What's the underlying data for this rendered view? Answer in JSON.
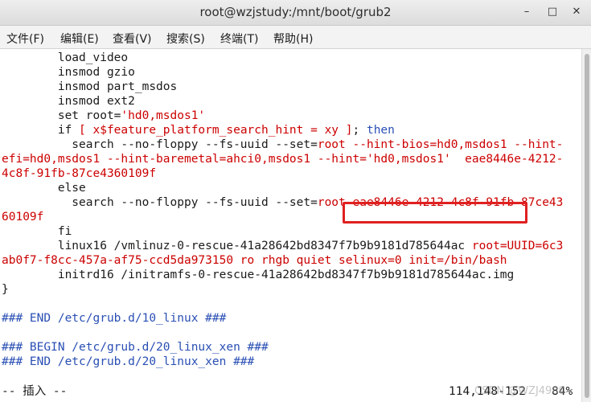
{
  "window": {
    "title": "root@wzjstudy:/mnt/boot/grub2",
    "minimize_glyph": "–",
    "maximize_glyph": "□",
    "close_glyph": "✕"
  },
  "menu": [
    "文件(F)",
    "编辑(E)",
    "查看(V)",
    "搜索(S)",
    "终端(T)",
    "帮助(H)"
  ],
  "lines": [
    [
      {
        "t": "        load_video",
        "c": ""
      }
    ],
    [
      {
        "t": "        insmod gzio",
        "c": ""
      }
    ],
    [
      {
        "t": "        insmod part_msdos",
        "c": ""
      }
    ],
    [
      {
        "t": "        insmod ext2",
        "c": ""
      }
    ],
    [
      {
        "t": "        set root=",
        "c": ""
      },
      {
        "t": "'hd0,msdos1'",
        "c": "red"
      }
    ],
    [
      {
        "t": "        if ",
        "c": ""
      },
      {
        "t": "[ x$feature_platform_search_hint = xy ]",
        "c": "red"
      },
      {
        "t": "; ",
        "c": ""
      },
      {
        "t": "then",
        "c": "blue"
      }
    ],
    [
      {
        "t": "          search --no-floppy --fs-uuid --set=",
        "c": ""
      },
      {
        "t": "root --hint-bios=hd0,msdos1 --hint-",
        "c": "red"
      }
    ],
    [
      {
        "t": "efi=hd0,msdos1 --hint-baremetal=ahci0,msdos1 --hint='hd0,msdos1'  eae8446e-4212-",
        "c": "red"
      }
    ],
    [
      {
        "t": "4c8f-91fb-87ce4360109f",
        "c": "red"
      }
    ],
    [
      {
        "t": "        else",
        "c": ""
      }
    ],
    [
      {
        "t": "          search --no-floppy --fs-uuid --set=",
        "c": ""
      },
      {
        "t": "root eae8446e-4212-4c8f-91fb-87ce43",
        "c": "red"
      }
    ],
    [
      {
        "t": "60109f",
        "c": "red"
      }
    ],
    [
      {
        "t": "        fi",
        "c": ""
      }
    ],
    [
      {
        "t": "        linux16 /vmlinuz-0-rescue-41a28642bd8347f7b9b9181d785644ac ",
        "c": ""
      },
      {
        "t": "root=UUID=6c3",
        "c": "red"
      }
    ],
    [
      {
        "t": "ab0f7-f8cc-457a-af75-ccd5da973150 ro rhgb quiet selinux=0 init=/bin/bash",
        "c": "red"
      }
    ],
    [
      {
        "t": "        initrd16 /initramfs-0-rescue-41a28642bd8347f7b9b9181d785644ac.img",
        "c": ""
      }
    ],
    [
      {
        "t": "}",
        "c": ""
      }
    ],
    [
      {
        "t": "",
        "c": ""
      }
    ],
    [
      {
        "t": "### END /etc/grub.d/10_linux ###",
        "c": "blue"
      }
    ],
    [
      {
        "t": "",
        "c": ""
      }
    ],
    [
      {
        "t": "### BEGIN /etc/grub.d/20_linux_xen ###",
        "c": "blue"
      }
    ],
    [
      {
        "t": "### END /etc/grub.d/20_linux_xen ###",
        "c": "blue"
      }
    ]
  ],
  "status": {
    "mode": "-- 插入 --",
    "position": "114,148-152",
    "percent": "84%",
    "watermark": "CSDN @WZJ4980"
  }
}
